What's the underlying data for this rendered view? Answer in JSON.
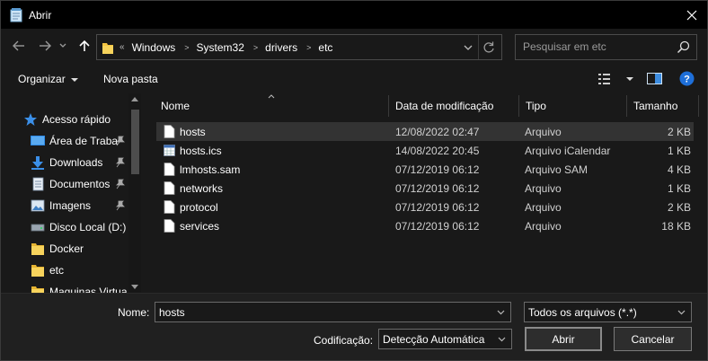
{
  "window": {
    "title": "Abrir"
  },
  "nav": {
    "breadcrumbs": [
      "Windows",
      "System32",
      "drivers",
      "etc"
    ],
    "overflow_glyph": "«",
    "search_placeholder": "Pesquisar em etc"
  },
  "toolbar": {
    "organize_label": "Organizar",
    "new_folder_label": "Nova pasta"
  },
  "sidebar": {
    "items": [
      {
        "label": "Acesso rápido",
        "icon": "star-icon",
        "pinned": false
      },
      {
        "label": "Área de Traba",
        "icon": "desktop-icon",
        "pinned": true
      },
      {
        "label": "Downloads",
        "icon": "download-icon",
        "pinned": true
      },
      {
        "label": "Documentos",
        "icon": "document-icon",
        "pinned": true
      },
      {
        "label": "Imagens",
        "icon": "image-icon",
        "pinned": true
      },
      {
        "label": "Disco Local (D:)",
        "icon": "drive-icon",
        "pinned": false
      },
      {
        "label": "Docker",
        "icon": "folder-icon",
        "pinned": false
      },
      {
        "label": "etc",
        "icon": "folder-icon",
        "pinned": false
      },
      {
        "label": "Maquinas Virtua",
        "icon": "folder-icon",
        "pinned": false
      }
    ]
  },
  "files": {
    "columns": [
      "Nome",
      "Data de modificação",
      "Tipo",
      "Tamanho"
    ],
    "rows": [
      {
        "name": "hosts",
        "date": "12/08/2022 02:47",
        "type": "Arquivo",
        "size": "2 KB",
        "icon": "file-icon",
        "selected": true
      },
      {
        "name": "hosts.ics",
        "date": "14/08/2022 20:45",
        "type": "Arquivo iCalendar",
        "size": "1 KB",
        "icon": "calendar-file-icon",
        "selected": false
      },
      {
        "name": "lmhosts.sam",
        "date": "07/12/2019 06:12",
        "type": "Arquivo SAM",
        "size": "4 KB",
        "icon": "file-icon",
        "selected": false
      },
      {
        "name": "networks",
        "date": "07/12/2019 06:12",
        "type": "Arquivo",
        "size": "1 KB",
        "icon": "file-icon",
        "selected": false
      },
      {
        "name": "protocol",
        "date": "07/12/2019 06:12",
        "type": "Arquivo",
        "size": "2 KB",
        "icon": "file-icon",
        "selected": false
      },
      {
        "name": "services",
        "date": "07/12/2019 06:12",
        "type": "Arquivo",
        "size": "18 KB",
        "icon": "file-icon",
        "selected": false
      }
    ]
  },
  "bottom": {
    "name_label": "Nome:",
    "name_value": "hosts",
    "filter_value": "Todos os arquivos  (*.*)",
    "encoding_label": "Codificação:",
    "encoding_value": "Detecção Automática",
    "open_label": "Abrir",
    "cancel_label": "Cancelar"
  },
  "colors": {
    "background": "#191919",
    "title_bar": "#000000",
    "selection": "#333333",
    "bottom_bar": "#202020",
    "help": "#1e6fd9",
    "star": "#3b8fe8",
    "folder": "#f5c542"
  }
}
